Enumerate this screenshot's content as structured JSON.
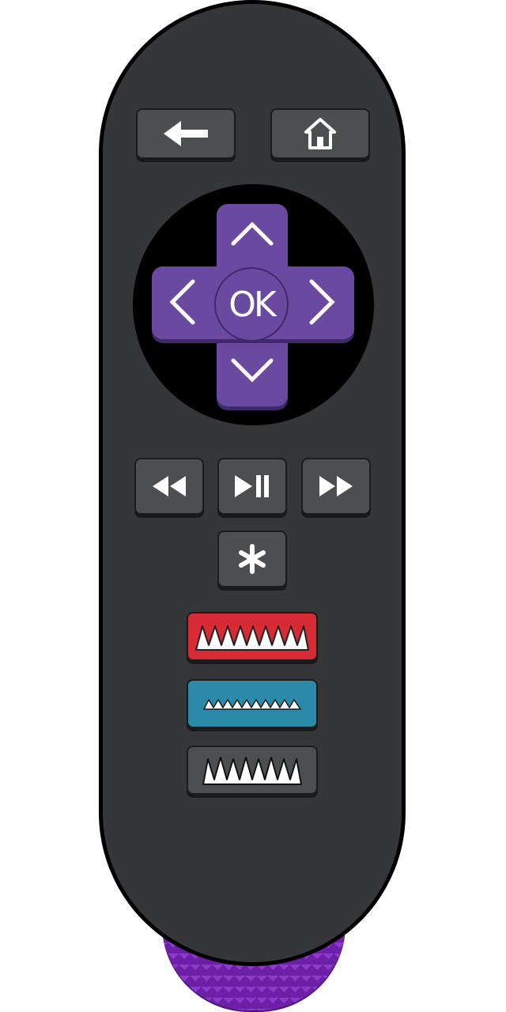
{
  "remote": {
    "colors": {
      "body": "#343637",
      "outline": "#000000",
      "key": "#4d4e4f",
      "dpad": "#6a4aa0",
      "red_key": "#d62a34",
      "blue_key": "#2b8aa8",
      "base": "#6d1fa8"
    },
    "top_row": [
      {
        "name": "back",
        "icon": "arrow-left-icon"
      },
      {
        "name": "home",
        "icon": "home-icon"
      }
    ],
    "dpad": {
      "ok_label": "OK",
      "arrows": [
        "chevron-up-icon",
        "chevron-down-icon",
        "chevron-left-icon",
        "chevron-right-icon"
      ]
    },
    "media_row": [
      {
        "name": "rewind",
        "icon": "rewind-icon"
      },
      {
        "name": "play-pause",
        "icon": "play-pause-icon"
      },
      {
        "name": "fast-forward",
        "icon": "fast-forward-icon"
      }
    ],
    "options": {
      "icon": "asterisk-icon",
      "glyph": "*"
    },
    "channel_keys": [
      {
        "name": "red-channel",
        "color": "#d62a34"
      },
      {
        "name": "blue-channel",
        "color": "#2b8aa8"
      },
      {
        "name": "gray-channel",
        "color": "#4d4e4f"
      }
    ]
  }
}
